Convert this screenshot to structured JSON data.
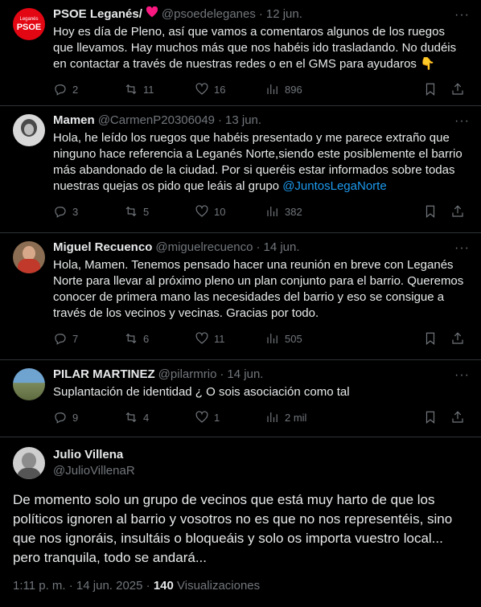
{
  "tweets": [
    {
      "name": "PSOE Leganés/",
      "handle": "@psoedeleganes",
      "date": "12 jun.",
      "text": "Hoy es día de Pleno, así que vamos a comentaros algunos de los ruegos que llevamos. Hay muchos más que nos habéis ido trasladando. No dudéis en contactar a través de nuestras redes o en el GMS para ayudaros 👇",
      "replies": "2",
      "reposts": "11",
      "likes": "16",
      "views": "896",
      "avatar_text": "Leganés",
      "avatar_brand": "PSOE"
    },
    {
      "name": "Mamen",
      "handle": "@CarmenP20306049",
      "date": "13 jun.",
      "text": "Hola, he leído los ruegos que habéis presentado y me parece extraño que ninguno hace referencia a Leganés Norte,siendo este posiblemente el barrio más abandonado de la ciudad. Por si queréis estar informados sobre todas nuestras quejas os pido que leáis al grupo ",
      "link": "@JuntosLegaNorte",
      "replies": "3",
      "reposts": "5",
      "likes": "10",
      "views": "382"
    },
    {
      "name": "Miguel Recuenco",
      "handle": "@miguelrecuenco",
      "date": "14 jun.",
      "text": "Hola, Mamen. Tenemos pensado hacer una reunión en breve con Leganés Norte para llevar al próximo pleno un plan conjunto para el barrio. Queremos conocer de primera mano las necesidades del barrio y eso se consigue a través de los vecinos y vecinas. Gracias por todo.",
      "replies": "7",
      "reposts": "6",
      "likes": "11",
      "views": "505"
    },
    {
      "name": "PILAR MARTINEZ",
      "handle": "@pilarmrio",
      "date": "14 jun.",
      "text": "Suplantación de identidad ¿ O sois asociación como tal",
      "replies": "9",
      "reposts": "4",
      "likes": "1",
      "views": "2 mil"
    }
  ],
  "main": {
    "name": "Julio Villena",
    "handle": "@JulioVillenaR",
    "text": "De momento solo un grupo de vecinos que está muy harto de que los políticos ignoren al barrio y vosotros no es que no nos representéis, sino que nos ignoráis, insultáis o bloqueáis y solo os importa vuestro local... pero tranquila, todo se andará...",
    "time": "1:11 p. m. · 14 jun. 2025 · ",
    "views_count": "140",
    "views_label": " Visualizaciones"
  },
  "colors": {
    "accent": "#1d9bf0",
    "muted": "#71767b",
    "heart": "#f91880",
    "brand": "#e30613"
  },
  "icons": [
    "heart-emoji",
    "more-icon",
    "reply-icon",
    "repost-icon",
    "like-icon",
    "views-icon",
    "bookmark-icon",
    "share-icon"
  ]
}
